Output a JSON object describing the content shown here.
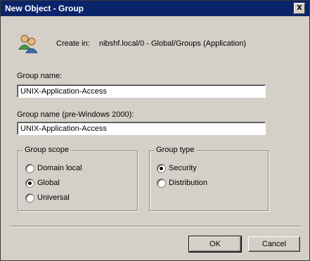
{
  "window": {
    "title": "New Object - Group",
    "close_label": "X"
  },
  "header": {
    "icon": "group-icon",
    "create_in_label": "Create in:",
    "create_in_path": "nibshf.local/0 - Global/Groups (Application)"
  },
  "form": {
    "group_name_label": "Group name:",
    "group_name_value": "UNIX-Application-Access",
    "pre2000_label": "Group name (pre-Windows 2000):",
    "pre2000_value": "UNIX-Application-Access"
  },
  "group_scope": {
    "title": "Group scope",
    "options": [
      "Domain local",
      "Global",
      "Universal"
    ],
    "selected": "Global"
  },
  "group_type": {
    "title": "Group type",
    "options": [
      "Security",
      "Distribution"
    ],
    "selected": "Security"
  },
  "buttons": {
    "ok": "OK",
    "cancel": "Cancel"
  }
}
